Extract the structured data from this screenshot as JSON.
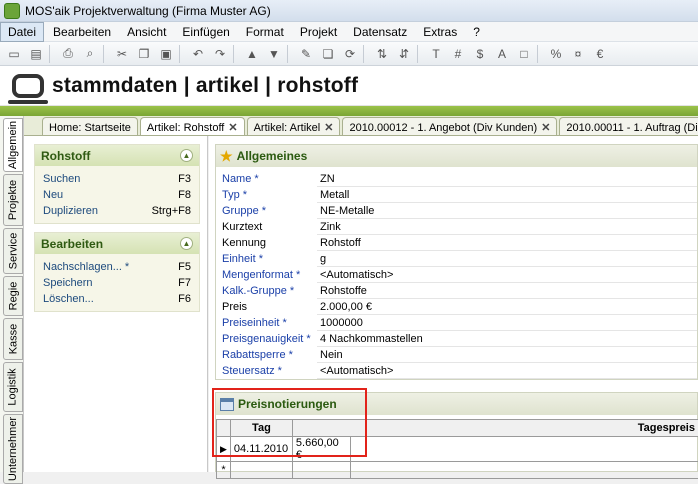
{
  "window": {
    "title": "MOS'aik Projektverwaltung (Firma Muster AG)"
  },
  "menu": [
    "Datei",
    "Bearbeiten",
    "Ansicht",
    "Einfügen",
    "Format",
    "Projekt",
    "Datensatz",
    "Extras",
    "?"
  ],
  "toolbar_icons": [
    "new-icon",
    "open-icon",
    "print-icon",
    "preview-icon",
    "cut-icon",
    "copy-icon",
    "paste-icon",
    "undo-icon",
    "redo-icon",
    "up-icon",
    "down-icon",
    "edit-icon",
    "copy-doc-icon",
    "refresh-icon",
    "sort-asc-icon",
    "sort-desc-icon",
    "text-icon",
    "hash-icon",
    "dollar-icon",
    "percent-icon",
    "currency-icon",
    "euro-icon"
  ],
  "banner": {
    "title": "stammdaten | artikel | rohstoff"
  },
  "vtabs": [
    "Allgemein",
    "Projekte",
    "Service",
    "Regie",
    "Kasse",
    "Logistik",
    "Unternehmer"
  ],
  "tabs": [
    {
      "label": "Home: Startseite",
      "close": false
    },
    {
      "label": "Artikel: Rohstoff",
      "close": true
    },
    {
      "label": "Artikel: Artikel",
      "close": true
    },
    {
      "label": "2010.00012 - 1. Angebot (Div Kunden)",
      "close": true
    },
    {
      "label": "2010.00011 - 1. Auftrag (Di",
      "close": false
    }
  ],
  "tasks": [
    {
      "title": "Rohstoff",
      "items": [
        {
          "label": "Suchen",
          "key": "F3"
        },
        {
          "label": "Neu",
          "key": "F8"
        },
        {
          "label": "Duplizieren",
          "key": "Strg+F8"
        }
      ]
    },
    {
      "title": "Bearbeiten",
      "items": [
        {
          "label": "Nachschlagen... *",
          "key": "F5"
        },
        {
          "label": "Speichern",
          "key": "F7"
        },
        {
          "label": "Löschen...",
          "key": "F6"
        }
      ]
    }
  ],
  "general": {
    "title": "Allgemeines",
    "fields": [
      {
        "label": "Name *",
        "value": "ZN",
        "required": true
      },
      {
        "label": "Typ *",
        "value": "Metall",
        "required": true
      },
      {
        "label": "Gruppe *",
        "value": "NE-Metalle",
        "required": true
      },
      {
        "label": "Kurztext",
        "value": "Zink",
        "required": false
      },
      {
        "label": "Kennung",
        "value": "Rohstoff",
        "required": false
      },
      {
        "label": "Einheit *",
        "value": "g",
        "required": true
      },
      {
        "label": "Mengenformat *",
        "value": "<Automatisch>",
        "required": true
      },
      {
        "label": "Kalk.-Gruppe *",
        "value": "Rohstoffe",
        "required": true
      },
      {
        "label": "Preis",
        "value": "2.000,00 €",
        "required": false
      },
      {
        "label": "Preiseinheit *",
        "value": "1000000",
        "required": true
      },
      {
        "label": "Preisgenauigkeit *",
        "value": "4 Nachkommastellen",
        "required": true
      },
      {
        "label": "Rabattsperre *",
        "value": "Nein",
        "required": true
      },
      {
        "label": "Steuersatz *",
        "value": "<Automatisch>",
        "required": true
      }
    ]
  },
  "prices": {
    "title": "Preisnotierungen",
    "columns": [
      "Tag",
      "Tagespreis"
    ],
    "rows": [
      {
        "tag": "04.11.2010",
        "preis": "5.660,00 €"
      }
    ],
    "new_row_marker": "*"
  },
  "colors": {
    "accent_green": "#7aa534",
    "required_blue": "#1a3fa8",
    "highlight_red": "#e2231a"
  }
}
